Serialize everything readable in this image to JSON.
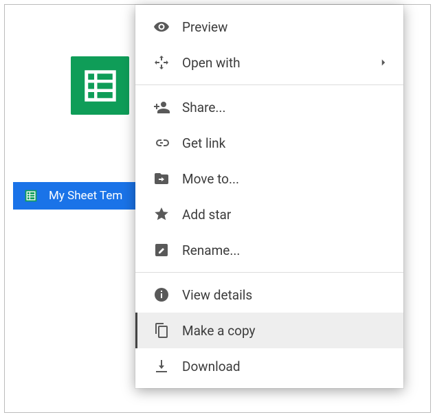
{
  "file": {
    "name": "My Sheet Tem",
    "type": "google-sheets"
  },
  "context_menu": {
    "groups": [
      [
        {
          "id": "preview",
          "label": "Preview",
          "icon": "eye-icon"
        },
        {
          "id": "open_with",
          "label": "Open with",
          "icon": "open-with-icon",
          "submenu": true
        }
      ],
      [
        {
          "id": "share",
          "label": "Share...",
          "icon": "person-add-icon"
        },
        {
          "id": "get_link",
          "label": "Get link",
          "icon": "link-icon"
        },
        {
          "id": "move_to",
          "label": "Move to...",
          "icon": "folder-move-icon"
        },
        {
          "id": "add_star",
          "label": "Add star",
          "icon": "star-icon"
        },
        {
          "id": "rename",
          "label": "Rename...",
          "icon": "rename-icon"
        }
      ],
      [
        {
          "id": "view_details",
          "label": "View details",
          "icon": "info-icon"
        },
        {
          "id": "make_copy",
          "label": "Make a copy",
          "icon": "copy-icon",
          "highlighted": true
        },
        {
          "id": "download",
          "label": "Download",
          "icon": "download-icon"
        }
      ]
    ]
  },
  "colors": {
    "sheets_green": "#0f9d58",
    "selection_blue": "#1a73e8",
    "icon_gray": "#595959",
    "highlight_gray": "#eeeeee"
  }
}
